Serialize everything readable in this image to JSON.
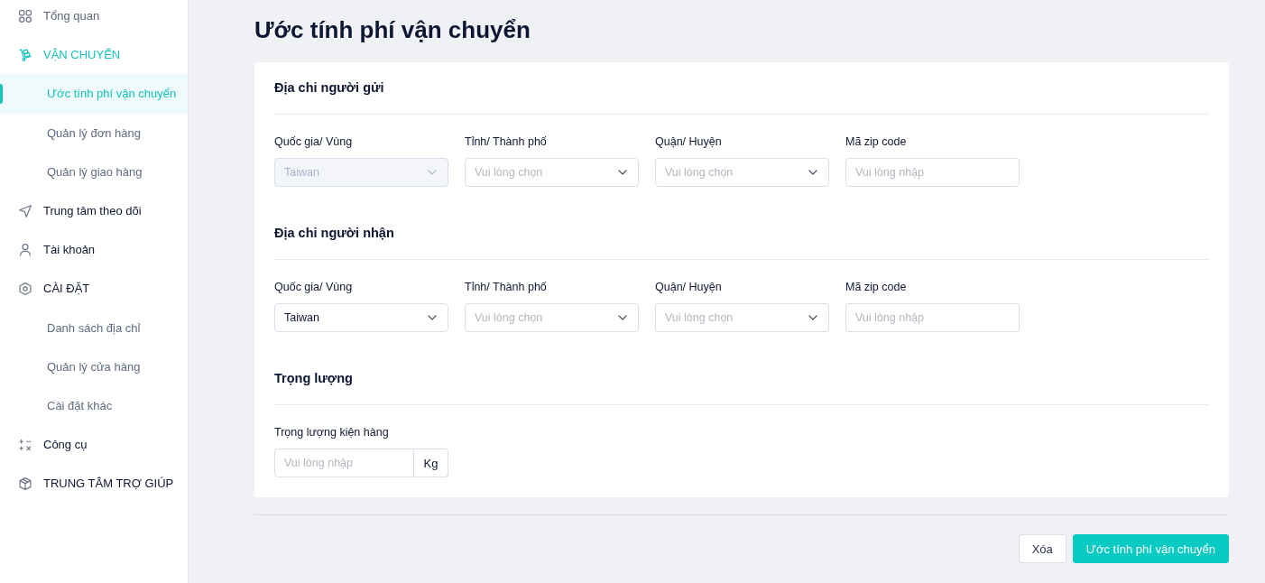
{
  "sidebar": {
    "items": [
      {
        "label": "Tổng quan",
        "active": false,
        "disabled": true
      },
      {
        "label": "VẬN CHUYỂN",
        "active": true,
        "disabled": false,
        "children": [
          {
            "label": "Ước tính phí vận chuyển",
            "selected": true
          },
          {
            "label": "Quản lý đơn hàng",
            "selected": false
          },
          {
            "label": "Quản lý giao hàng",
            "selected": false
          }
        ]
      },
      {
        "label": "Trung tâm theo dõi",
        "active": false,
        "disabled": false
      },
      {
        "label": "Tài khoản",
        "active": false,
        "disabled": false
      },
      {
        "label": "CÀI ĐẶT",
        "active": false,
        "disabled": false,
        "children": [
          {
            "label": "Danh sách địa chỉ",
            "selected": false
          },
          {
            "label": "Quản lý cửa hàng",
            "selected": false
          },
          {
            "label": "Cài đặt khác",
            "selected": false
          }
        ]
      },
      {
        "label": "Công cụ",
        "active": false,
        "disabled": false
      },
      {
        "label": "TRUNG TÂM TRỢ GIÚP",
        "active": false,
        "disabled": false
      }
    ]
  },
  "page": {
    "title": "Ước tính phí vận chuyển"
  },
  "form": {
    "sections": [
      {
        "heading": "Địa chi người gửi",
        "fields": [
          {
            "kind": "select",
            "label": "Quốc gia/ Vùng",
            "value": "Taiwan",
            "disabled": true
          },
          {
            "kind": "select",
            "label": "Tỉnh/ Thành phố",
            "placeholder": "Vui lòng chọn",
            "disabled": false
          },
          {
            "kind": "select",
            "label": "Quận/ Huyện",
            "placeholder": "Vui lòng chọn",
            "disabled": false
          },
          {
            "kind": "input",
            "label": "Mã zip code",
            "placeholder": "Vui lòng nhập",
            "disabled": false
          }
        ]
      },
      {
        "heading": "Địa chi người nhận",
        "fields": [
          {
            "kind": "select",
            "label": "Quốc gia/ Vùng",
            "value": "Taiwan",
            "disabled": false
          },
          {
            "kind": "select",
            "label": "Tỉnh/ Thành phố",
            "placeholder": "Vui lòng chọn",
            "disabled": false
          },
          {
            "kind": "select",
            "label": "Quận/ Huyện",
            "placeholder": "Vui lòng chọn",
            "disabled": false
          },
          {
            "kind": "input",
            "label": "Mã zip code",
            "placeholder": "Vui lòng nhập",
            "disabled": false
          }
        ]
      },
      {
        "heading": "Trọng lượng",
        "fields": [
          {
            "kind": "unit-input",
            "label": "Trọng lượng kiện hàng",
            "placeholder": "Vui lòng nhập",
            "unit": "Kg",
            "disabled": false
          }
        ]
      }
    ]
  },
  "buttons": [
    {
      "kind": "secondary",
      "label": "Xóa"
    },
    {
      "kind": "primary",
      "label": "Ước tính phí vận chuyển"
    }
  ]
}
